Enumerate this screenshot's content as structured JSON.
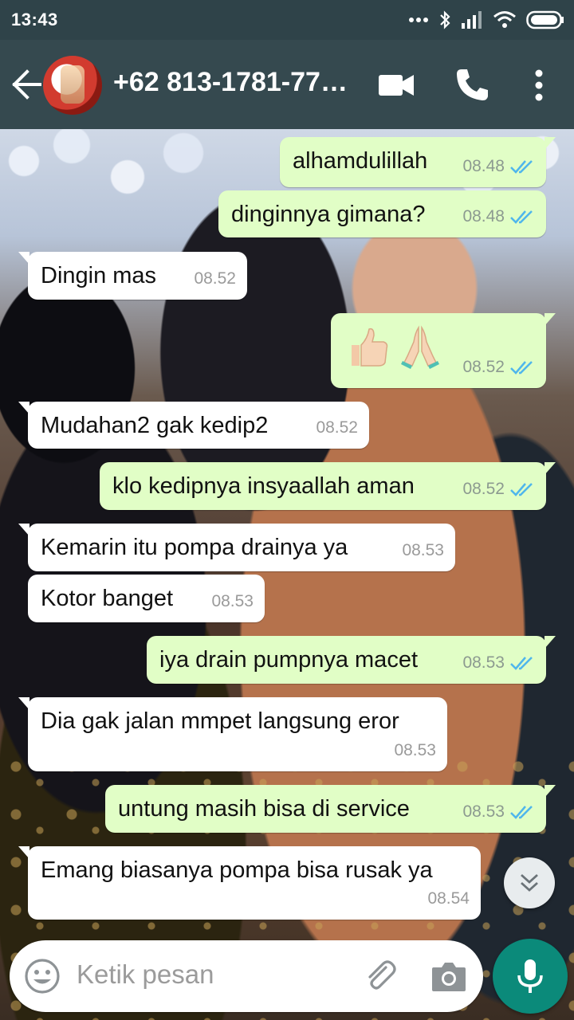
{
  "status_bar": {
    "time": "13:43"
  },
  "header": {
    "contact_name": "+62 813-1781-77…"
  },
  "messages": [
    {
      "dir": "out",
      "text": "alhamdulillah",
      "time": "08.48",
      "status": "read"
    },
    {
      "dir": "out",
      "text": "dinginnya gimana?",
      "time": "08.48",
      "status": "read"
    },
    {
      "dir": "in",
      "text": "Dingin mas",
      "time": "08.52"
    },
    {
      "dir": "out",
      "text": "👍🏻🙏",
      "time": "08.52",
      "status": "read",
      "emoji_names": [
        "thumbs-up-emoji",
        "folded-hands-emoji"
      ]
    },
    {
      "dir": "in",
      "text": "Mudahan2 gak kedip2",
      "time": "08.52"
    },
    {
      "dir": "out",
      "text": "klo kedipnya insyaallah aman",
      "time": "08.52",
      "status": "read"
    },
    {
      "dir": "in",
      "text": "Kemarin itu pompa drainya ya",
      "time": "08.53"
    },
    {
      "dir": "in",
      "text": "Kotor banget",
      "time": "08.53"
    },
    {
      "dir": "out",
      "text": "iya drain pumpnya macet",
      "time": "08.53",
      "status": "read"
    },
    {
      "dir": "in",
      "text": "Dia gak jalan mmpet langsung eror",
      "time": "08.53"
    },
    {
      "dir": "out",
      "text": "untung masih bisa di service",
      "time": "08.53",
      "status": "read"
    },
    {
      "dir": "in",
      "text": "Emang biasanya pompa bisa rusak ya",
      "time": "08.54"
    }
  ],
  "input": {
    "placeholder": "Ketik pesan"
  },
  "colors": {
    "status_bar": "#2f4349",
    "app_bar": "#35494f",
    "outgoing_bubble": "#e1fec6",
    "incoming_bubble": "#ffffff",
    "read_tick": "#4fb6ec",
    "mic_button": "#0b8a7a"
  },
  "icons": [
    "back-arrow-icon",
    "contact-avatar",
    "video-call-icon",
    "phone-call-icon",
    "more-options-icon",
    "emoji-icon",
    "attach-icon",
    "camera-icon",
    "mic-icon",
    "scroll-down-icon",
    "double-tick-icon"
  ]
}
